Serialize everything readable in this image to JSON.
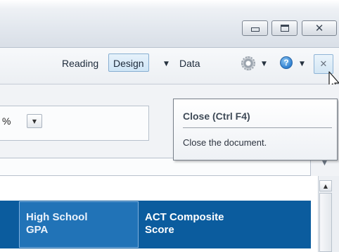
{
  "window_controls": {
    "minimize_icon": "minimize-icon",
    "maximize_icon": "maximize-icon",
    "close_glyph": "✕"
  },
  "toolbar": {
    "modes": {
      "reading": "Reading",
      "design": "Design",
      "data": "Data"
    },
    "caret_glyph": "▼",
    "settings_icon": "gear-icon",
    "help_glyph": "?",
    "close_document_glyph": "✕"
  },
  "properties": {
    "zoom_partial": "%",
    "dropdown_glyph": "▼",
    "side_caret_glyph": "▼"
  },
  "tooltip": {
    "title": "Close (Ctrl F4)",
    "description": "Close the document."
  },
  "table": {
    "columns": [
      {
        "line1": "High School",
        "line2": "GPA"
      },
      {
        "line1": "ACT Composite",
        "line2": "Score"
      }
    ]
  },
  "scrollbar": {
    "up_glyph": "▲"
  },
  "colors": {
    "header_band": "#0b5c9e",
    "selected_header": "#2173b7",
    "design_tab": "#cfe5f6"
  }
}
